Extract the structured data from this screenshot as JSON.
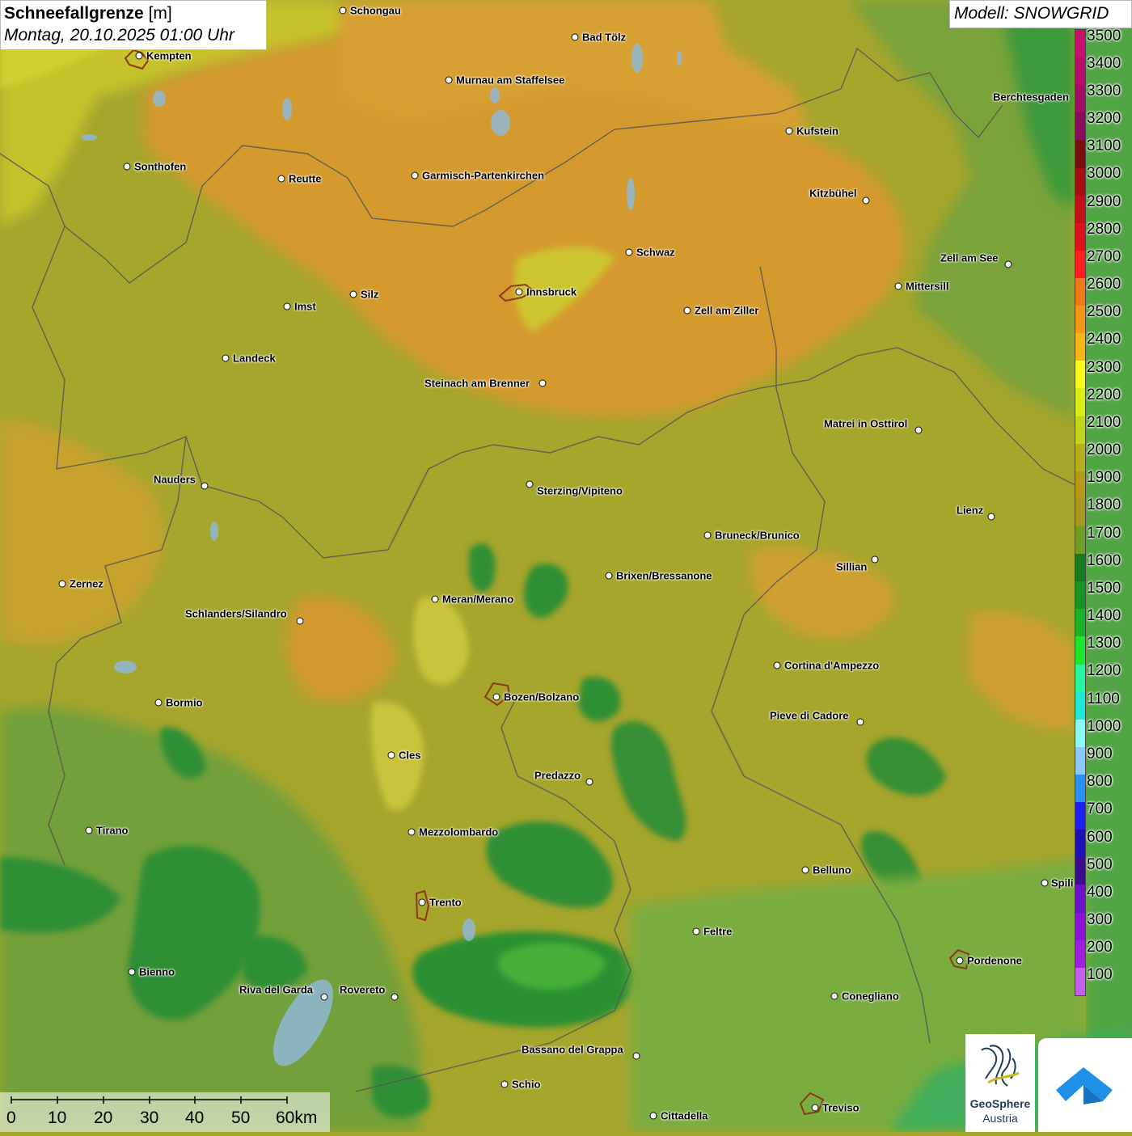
{
  "header": {
    "title_bold": "Schneefallgrenze",
    "title_unit": "[m]",
    "datetime": "Montag, 20.10.2025 01:00 Uhr",
    "model": "Modell: SNOWGRID"
  },
  "legend": {
    "labels": [
      "3500",
      "3400",
      "3300",
      "3200",
      "3100",
      "3000",
      "2900",
      "2800",
      "2700",
      "2600",
      "2500",
      "2400",
      "2300",
      "2200",
      "2100",
      "2000",
      "1900",
      "1800",
      "1700",
      "1600",
      "1500",
      "1400",
      "1300",
      "1200",
      "1100",
      "1000",
      "900",
      "800",
      "700",
      "600",
      "500",
      "400",
      "300",
      "200",
      "100"
    ],
    "colors": [
      "#c8106e",
      "#b50e6a",
      "#a00d63",
      "#8a0b5c",
      "#7a0d10",
      "#a50f12",
      "#c01018",
      "#dd1219",
      "#ff1d1d",
      "#f07a1b",
      "#f39816",
      "#f6b61b",
      "#ffff1e",
      "#d8ee1a",
      "#c2d41e",
      "#b8ad1c",
      "#b89a1b",
      "#a9981f",
      "#6f9e22",
      "#187b23",
      "#189425",
      "#19b325",
      "#1ee62c",
      "#28f5a0",
      "#1fe8d4",
      "#8cfaf9",
      "#8cc8f5",
      "#2d8ff2",
      "#1c20f0",
      "#1a12b4",
      "#3c0c90",
      "#6c12c8",
      "#8c12d8",
      "#a01ee0",
      "#c560ec"
    ]
  },
  "cities": [
    {
      "name": "Schongau",
      "dot": [
        424,
        13
      ],
      "label": [
        433,
        13
      ]
    },
    {
      "name": "Kempten",
      "dot": [
        172,
        69
      ],
      "label": [
        181,
        69
      ]
    },
    {
      "name": "Bad Tölz",
      "dot": [
        711,
        46
      ],
      "label": [
        720,
        46
      ]
    },
    {
      "name": "Murnau am Staffelsee",
      "dot": [
        555,
        99
      ],
      "label": [
        564,
        99
      ]
    },
    {
      "name": "Berchtesgaden",
      "dot": null,
      "label": [
        1228,
        120
      ]
    },
    {
      "name": "Kufstein",
      "dot": [
        976,
        162
      ],
      "label": [
        985,
        162
      ]
    },
    {
      "name": "Sonthofen",
      "dot": [
        157,
        206
      ],
      "label": [
        166,
        206
      ]
    },
    {
      "name": "Reutte",
      "dot": [
        348,
        221
      ],
      "label": [
        357,
        221
      ]
    },
    {
      "name": "Garmisch-Partenkirchen",
      "dot": [
        513,
        217
      ],
      "label": [
        522,
        217
      ]
    },
    {
      "name": "Kitzbühel",
      "dot": [
        1071,
        248
      ],
      "label": [
        1001,
        239
      ]
    },
    {
      "name": "Schwaz",
      "dot": [
        778,
        312
      ],
      "label": [
        787,
        312
      ]
    },
    {
      "name": "Zell am See",
      "dot": [
        1247,
        327
      ],
      "label": [
        1163,
        319
      ]
    },
    {
      "name": "Mittersill",
      "dot": [
        1111,
        354
      ],
      "label": [
        1120,
        354
      ]
    },
    {
      "name": "Innsbruck",
      "dot": [
        642,
        361
      ],
      "label": [
        651,
        361
      ]
    },
    {
      "name": "Silz",
      "dot": [
        437,
        364
      ],
      "label": [
        446,
        364
      ]
    },
    {
      "name": "Imst",
      "dot": [
        355,
        379
      ],
      "label": [
        364,
        379
      ]
    },
    {
      "name": "Zell am Ziller",
      "dot": [
        850,
        384
      ],
      "label": [
        859,
        384
      ]
    },
    {
      "name": "Landeck",
      "dot": [
        279,
        443
      ],
      "label": [
        288,
        443
      ]
    },
    {
      "name": "Steinach am Brenner",
      "dot": [
        671,
        474
      ],
      "label": [
        525,
        474
      ]
    },
    {
      "name": "Matrei in Osttirol",
      "dot": [
        1136,
        532
      ],
      "label": [
        1019,
        524
      ]
    },
    {
      "name": "Nauders",
      "dot": [
        253,
        601
      ],
      "label": [
        190,
        593
      ]
    },
    {
      "name": "Sterzing/Vipiteno",
      "dot": [
        655,
        599
      ],
      "label": [
        664,
        607
      ]
    },
    {
      "name": "Lienz",
      "dot": [
        1226,
        639
      ],
      "label": [
        1183,
        631
      ]
    },
    {
      "name": "Bruneck/Brunico",
      "dot": [
        875,
        662
      ],
      "label": [
        884,
        662
      ]
    },
    {
      "name": "Sillian",
      "dot": [
        1082,
        692
      ],
      "label": [
        1034,
        701
      ]
    },
    {
      "name": "Brixen/Bressanone",
      "dot": [
        753,
        712
      ],
      "label": [
        762,
        712
      ]
    },
    {
      "name": "Zernez",
      "dot": [
        77,
        722
      ],
      "label": [
        86,
        722
      ]
    },
    {
      "name": "Meran/Merano",
      "dot": [
        538,
        741
      ],
      "label": [
        547,
        741
      ]
    },
    {
      "name": "Schlanders/Silandro",
      "dot": [
        371,
        768
      ],
      "label": [
        229,
        759
      ]
    },
    {
      "name": "Cortina d'Ampezzo",
      "dot": [
        961,
        823
      ],
      "label": [
        970,
        823
      ]
    },
    {
      "name": "Bozen/Bolzano",
      "dot": [
        614,
        862
      ],
      "label": [
        623,
        862
      ]
    },
    {
      "name": "Bormio",
      "dot": [
        196,
        869
      ],
      "label": [
        205,
        869
      ]
    },
    {
      "name": "Pieve di Cadore",
      "dot": [
        1064,
        893
      ],
      "label": [
        952,
        885
      ]
    },
    {
      "name": "Cles",
      "dot": [
        484,
        934
      ],
      "label": [
        493,
        934
      ]
    },
    {
      "name": "Predazzo",
      "dot": [
        729,
        967
      ],
      "label": [
        661,
        959
      ]
    },
    {
      "name": "Tirano",
      "dot": [
        110,
        1027
      ],
      "label": [
        119,
        1027
      ]
    },
    {
      "name": "Mezzolombardo",
      "dot": [
        509,
        1029
      ],
      "label": [
        518,
        1029
      ]
    },
    {
      "name": "Belluno",
      "dot": [
        996,
        1076
      ],
      "label": [
        1005,
        1076
      ]
    },
    {
      "name": "Trento",
      "dot": [
        522,
        1116
      ],
      "label": [
        531,
        1116
      ]
    },
    {
      "name": "Feltre",
      "dot": [
        861,
        1152
      ],
      "label": [
        870,
        1152
      ]
    },
    {
      "name": "Pordenone",
      "dot": [
        1187,
        1188
      ],
      "label": [
        1196,
        1188
      ]
    },
    {
      "name": "Bienno",
      "dot": [
        163,
        1202
      ],
      "label": [
        172,
        1202
      ]
    },
    {
      "name": "Riva del Garda",
      "dot": [
        401,
        1233
      ],
      "label": [
        296,
        1224
      ]
    },
    {
      "name": "Rovereto",
      "dot": [
        488,
        1233
      ],
      "label": [
        420,
        1224
      ]
    },
    {
      "name": "Conegliano",
      "dot": [
        1032,
        1232
      ],
      "label": [
        1041,
        1232
      ]
    },
    {
      "name": "Bassano del Grappa",
      "dot": [
        787,
        1306
      ],
      "label": [
        645,
        1298
      ]
    },
    {
      "name": "Schio",
      "dot": [
        624,
        1341
      ],
      "label": [
        633,
        1341
      ]
    },
    {
      "name": "Treviso",
      "dot": [
        1008,
        1370
      ],
      "label": [
        1017,
        1370
      ]
    },
    {
      "name": "Cittadella",
      "dot": [
        808,
        1380
      ],
      "label": [
        817,
        1380
      ]
    },
    {
      "name": "Spili",
      "dot": [
        1292,
        1092
      ],
      "label": [
        1300,
        1092
      ]
    }
  ],
  "scale_bar": {
    "labels": [
      "0",
      "10",
      "20",
      "30",
      "40",
      "50",
      "60km"
    ]
  },
  "logos": {
    "geosphere_line1": "GeoSphere",
    "geosphere_line2": "Austria"
  },
  "colors": {
    "snowline_low": "#3f9a2f",
    "snowline_mid": "#a6a52c",
    "snowline_high": "#d29a2e",
    "lake": "#8fb9d6",
    "border": "#555555"
  }
}
